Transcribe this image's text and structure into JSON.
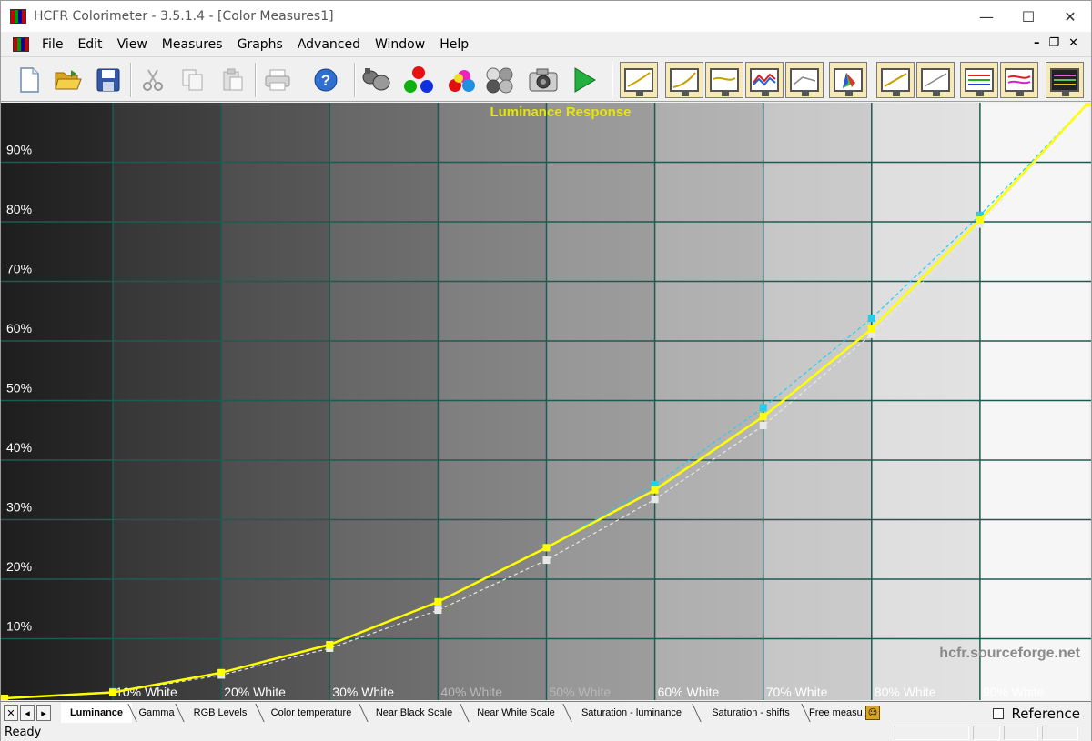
{
  "window": {
    "title": "HCFR Colorimeter - 3.5.1.4 - [Color Measures1]",
    "controls": [
      "minimize-icon",
      "maximize-icon",
      "close-icon"
    ]
  },
  "menu": {
    "items": [
      {
        "label": "File"
      },
      {
        "label": "Edit"
      },
      {
        "label": "View"
      },
      {
        "label": "Measures"
      },
      {
        "label": "Graphs"
      },
      {
        "label": "Advanced"
      },
      {
        "label": "Window"
      },
      {
        "label": "Help"
      }
    ]
  },
  "toolbar": {
    "file_icons": [
      "new-document-icon",
      "open-folder-icon",
      "save-disk-icon"
    ],
    "edit_icons": [
      "cut-icon",
      "copy-icon",
      "paste-icon"
    ],
    "misc_icons": [
      "print-icon",
      "help-icon"
    ],
    "measure_icons": [
      "sensor-icon",
      "rgb-primaries-icon",
      "secondaries-icon",
      "grayscale-icon",
      "camera-icon",
      "play-icon"
    ],
    "graph_icons": [
      "graph-view-1-icon",
      "graph-view-2-icon",
      "graph-view-3-icon",
      "graph-view-4-icon",
      "graph-view-5-icon",
      "cie-chart-icon",
      "graph-view-7-icon",
      "graph-view-8-icon",
      "rgb-levels-graph-icon",
      "gamma-graph-icon",
      "spectrum-graph-icon"
    ]
  },
  "chart_data": {
    "type": "line",
    "title": "Luminance Response",
    "y_tick_labels": [
      "10%",
      "20%",
      "30%",
      "40%",
      "50%",
      "60%",
      "70%",
      "80%",
      "90%"
    ],
    "x_tick_labels": [
      "10% White",
      "20% White",
      "30% White",
      "40% White",
      "50% White",
      "60% White",
      "70% White",
      "80% White",
      "90% White"
    ],
    "ylim": [
      0,
      100
    ],
    "xlim": [
      0,
      100
    ],
    "x": [
      0,
      10,
      20,
      30,
      40,
      50,
      60,
      70,
      80,
      90,
      100
    ],
    "series": [
      {
        "values": [
          0,
          1.0,
          4.3,
          9.0,
          16.2,
          25.3,
          35.0,
          47.3,
          62.0,
          80.3,
          100
        ],
        "color": "#ffff00"
      },
      {
        "values": [
          0,
          1.1,
          4.3,
          9.0,
          16.2,
          25.3,
          35.9,
          48.8,
          63.8,
          81.1,
          100
        ],
        "color": "#20d0e8"
      },
      {
        "values": [
          0,
          1.0,
          3.9,
          8.4,
          14.8,
          23.2,
          33.4,
          45.8,
          61.1,
          79.6,
          100
        ],
        "color": "#e8e8e8"
      }
    ],
    "grid": true,
    "background": "black-to-white gradient columns",
    "watermark": "hcfr.sourceforge.net"
  },
  "tabs": {
    "items": [
      {
        "label": "Luminance",
        "active": true
      },
      {
        "label": "Gamma",
        "active": false
      },
      {
        "label": "RGB Levels",
        "active": false
      },
      {
        "label": "Color temperature",
        "active": false
      },
      {
        "label": "Near Black Scale",
        "active": false
      },
      {
        "label": "Near White Scale",
        "active": false
      },
      {
        "label": "Saturation - luminance",
        "active": false
      },
      {
        "label": "Saturation - shifts",
        "active": false
      },
      {
        "label": "Free measu",
        "active": false
      }
    ],
    "reference_label": "Reference",
    "reference_checked": false
  },
  "status": {
    "text": "Ready"
  },
  "colors": {
    "grid": "#1f5a50",
    "title": "#e6e600",
    "luminance": "#ffff00",
    "reference": "#20d0e8"
  }
}
